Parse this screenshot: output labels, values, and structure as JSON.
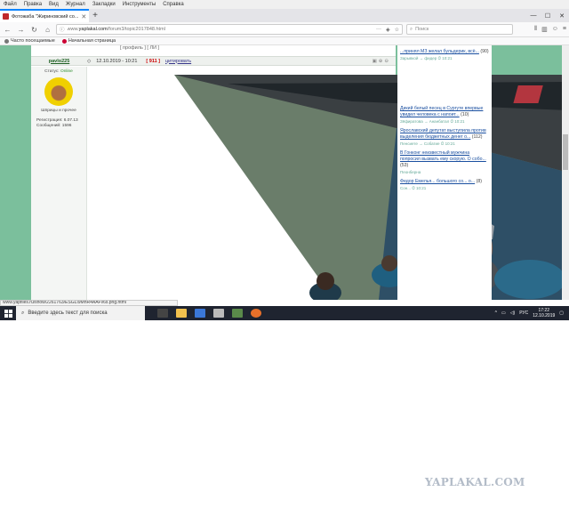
{
  "menu": [
    "Файл",
    "Правка",
    "Вид",
    "Журнал",
    "Закладки",
    "Инструменты",
    "Справка"
  ],
  "tab": {
    "title": "Фотожаба \"Жириновский со..."
  },
  "nav": {
    "url_prefix": "www.",
    "url_host": "yaplakal.com",
    "url_path": "/forum3/topic2017848.html",
    "search_placeholder": "Поиск"
  },
  "bookmarks": [
    {
      "label": "Часто посещаемые"
    },
    {
      "label": "Начальная страница"
    }
  ],
  "post": {
    "profile_strip": "[ профиль ] [ ЛИ ]",
    "author": "pavlo225",
    "date": "12.10.2019 - 10:21",
    "rating": "[ 911 ]",
    "quote": "цитировать",
    "status_label": "Статус:",
    "status_value": "Online",
    "user_tag": "Шприцы и прочее",
    "registered": "Регистрация: 6.07.13",
    "messages": "Сообщений: 1596"
  },
  "sidebar": [
    {
      "title": "...принял МЗ желал бульдерик, всё...",
      "count": "(90)",
      "meta": "Зарывкой → фидер ⏱ 10:21"
    },
    {
      "title": "Дикий белый песец в Сургуте впервые увидел человека с напоит...",
      "count": "(10)",
      "meta": "Зёфиратова → Ананбатал ⏱ 10:21"
    },
    {
      "title": "Ярославский депутат выступила против выделения бюджетных денег о...",
      "count": "(112)",
      "meta": "Пенсиете → Собатие ⏱ 10:21"
    },
    {
      "title": "В Гонконг неизвестный мужчина попросил вызвать ему скорую. О собо...",
      "count": "(53)",
      "meta": "Пеонберна"
    },
    {
      "title": "Федор Емелья... большого со... о...",
      "count": "(8)",
      "meta": "Сон... ⏱ 10:21"
    }
  ],
  "statusbar": "www.yapfiles.ru/show/2261763/ESGLI9MhR4AAFv6s.png.html",
  "taskbar": {
    "search_text": "Введите здесь текст для поиска",
    "lang": "РУС",
    "time": "17:22",
    "date": "12.10.2019"
  },
  "watermark": "YAPLAKAL.COM",
  "colors": {
    "page_bg": "#7bbf9c",
    "link": "#1a4fa0",
    "accent_tab": "#0a84ff",
    "taskbar": "#1f2430"
  }
}
